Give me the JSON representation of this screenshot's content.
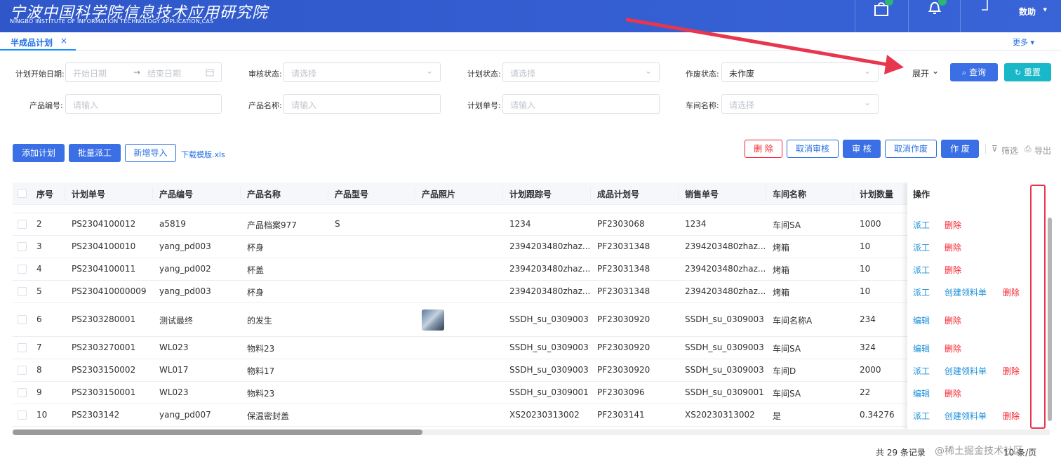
{
  "header": {
    "logo_cn": "宁波中国科学院信息技术应用研究院",
    "logo_en": "NINGBO INSTITUTE OF INFORMATION TECHNOLOGY APPLICATION,CAS",
    "user_name": "数助",
    "caret": "▾",
    "cart_icon": "cart-icon",
    "bell_icon": "bell-icon"
  },
  "tabs": {
    "active_label": "半成品计划",
    "close": "×",
    "more": "更多 ▾"
  },
  "filters": {
    "start_date_label": "计划开始日期:",
    "start_ph": "开始日期",
    "arrow": "→",
    "end_ph": "结束日期",
    "audit_label": "审核状态:",
    "audit_ph": "请选择",
    "plan_status_label": "计划状态:",
    "plan_status_ph": "请选择",
    "void_label": "作废状态:",
    "void_value": "未作废",
    "product_code_label": "产品编号:",
    "product_code_ph": "请输入",
    "product_name_label": "产品名称:",
    "product_name_ph": "请输入",
    "plan_no_label": "计划单号:",
    "plan_no_ph": "请输入",
    "workshop_label": "车间名称:",
    "workshop_ph": "请选择",
    "expand": "展开",
    "query": "查询",
    "reset": "重置"
  },
  "toolbar": {
    "add_plan": "添加计划",
    "batch_dispatch": "批量派工",
    "import": "新增导入",
    "template_link": "下载模版.xls",
    "delete": "删 除",
    "cancel_audit": "取消审核",
    "audit": "审 核",
    "cancel_void": "取消作废",
    "void": "作 废",
    "filter": "筛选",
    "export": "导出"
  },
  "table": {
    "columns": [
      "序号",
      "计划单号",
      "产品编号",
      "产品名称",
      "产品型号",
      "产品照片",
      "计划跟踪号",
      "成品计划号",
      "销售单号",
      "车间名称",
      "计划数量",
      "操作"
    ],
    "rows": [
      {
        "idx": "2",
        "plan_no": "PS2304100012",
        "code": "a5819",
        "name": "产品档案977",
        "model": "S",
        "photo": false,
        "track": "1234",
        "finished": "PF2303068",
        "sales": "1234",
        "workshop": "车间SA",
        "qty": "1000",
        "ops": [
          "派工",
          "删除"
        ]
      },
      {
        "idx": "3",
        "plan_no": "PS2304100010",
        "code": "yang_pd003",
        "name": "杯身",
        "model": "",
        "photo": false,
        "track": "2394203480zhaz...",
        "finished": "PF23031348",
        "sales": "2394203480zhaz...",
        "workshop": "烤箱",
        "qty": "10",
        "ops": [
          "派工",
          "删除"
        ]
      },
      {
        "idx": "4",
        "plan_no": "PS2304100011",
        "code": "yang_pd002",
        "name": "杯盖",
        "model": "",
        "photo": false,
        "track": "2394203480zhaz...",
        "finished": "PF23031348",
        "sales": "2394203480zhaz...",
        "workshop": "烤箱",
        "qty": "10",
        "ops": [
          "派工",
          "删除"
        ]
      },
      {
        "idx": "5",
        "plan_no": "PS230410000009",
        "code": "yang_pd003",
        "name": "杯身",
        "model": "",
        "photo": false,
        "track": "2394203480zhaz...",
        "finished": "PF23031348",
        "sales": "2394203480zhaz...",
        "workshop": "烤箱",
        "qty": "10",
        "ops": [
          "派工",
          "创建领料单",
          "删除"
        ]
      },
      {
        "idx": "6",
        "plan_no": "PS2303280001",
        "code": "测试最终",
        "name": "的发生",
        "model": "",
        "photo": true,
        "track": "SSDH_su_0309003",
        "finished": "PF23030920",
        "sales": "SSDH_su_0309003",
        "workshop": "车间名称A",
        "qty": "234",
        "ops": [
          "编辑",
          "删除"
        ]
      },
      {
        "idx": "7",
        "plan_no": "PS2303270001",
        "code": "WL023",
        "name": "物料23",
        "model": "",
        "photo": false,
        "track": "SSDH_su_0309003",
        "finished": "PF23030920",
        "sales": "SSDH_su_0309003",
        "workshop": "车间SA",
        "qty": "324",
        "ops": [
          "编辑",
          "删除"
        ]
      },
      {
        "idx": "8",
        "plan_no": "PS2303150002",
        "code": "WL017",
        "name": "物料17",
        "model": "",
        "photo": false,
        "track": "SSDH_su_0309003",
        "finished": "PF23030920",
        "sales": "SSDH_su_0309003",
        "workshop": "车间D",
        "qty": "2000",
        "ops": [
          "派工",
          "创建领料单",
          "删除"
        ]
      },
      {
        "idx": "9",
        "plan_no": "PS2303150001",
        "code": "WL023",
        "name": "物料23",
        "model": "",
        "photo": false,
        "track": "SSDH_su_0309001",
        "finished": "PF2303096",
        "sales": "SSDH_su_0309001",
        "workshop": "车间SA",
        "qty": "22",
        "ops": [
          "编辑",
          "删除"
        ]
      },
      {
        "idx": "10",
        "plan_no": "PS2303142",
        "code": "yang_pd007",
        "name": "保温密封盖",
        "model": "",
        "photo": false,
        "track": "XS20230313002",
        "finished": "PF2303141",
        "sales": "XS20230313002",
        "workshop": "是",
        "qty": "0.34276",
        "ops": [
          "派工",
          "创建领料单",
          "删除"
        ]
      }
    ]
  },
  "pagination": {
    "total": "共 29 条记录",
    "page_size": "10 条/页"
  },
  "watermark": "@稀土掘金技术社区",
  "colors": {
    "brand": "#3a6fe5",
    "teal": "#18b8c8",
    "danger": "#f5222d",
    "link": "#1a8fd9",
    "annotation": "#e8364f"
  }
}
